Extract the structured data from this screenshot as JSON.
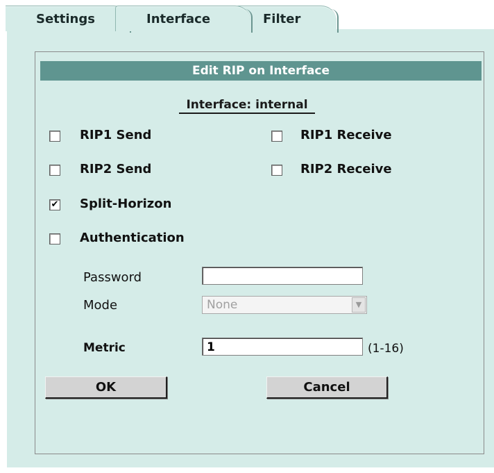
{
  "tabs": [
    {
      "label": "Settings"
    },
    {
      "label": "Interface"
    },
    {
      "label": "Filter"
    }
  ],
  "dialog": {
    "title": "Edit RIP on Interface",
    "interface_label": "Interface: internal",
    "rip1_send": {
      "label": "RIP1 Send",
      "checked": false,
      "mark": ""
    },
    "rip1_receive": {
      "label": "RIP1 Receive",
      "checked": false,
      "mark": ""
    },
    "rip2_send": {
      "label": "RIP2 Send",
      "checked": false,
      "mark": ""
    },
    "rip2_receive": {
      "label": "RIP2 Receive",
      "checked": false,
      "mark": ""
    },
    "split_horizon": {
      "label": "Split-Horizon",
      "checked": true,
      "mark": "✔"
    },
    "authentication": {
      "label": "Authentication",
      "checked": false,
      "mark": ""
    },
    "password": {
      "label": "Password",
      "value": ""
    },
    "mode": {
      "label": "Mode",
      "selected": "None",
      "disabled": true
    },
    "metric": {
      "label": "Metric",
      "value": "1",
      "range": "(1-16)"
    },
    "ok_label": "OK",
    "cancel_label": "Cancel"
  },
  "icons": {
    "select_arrow": "chevron-down-icon"
  }
}
